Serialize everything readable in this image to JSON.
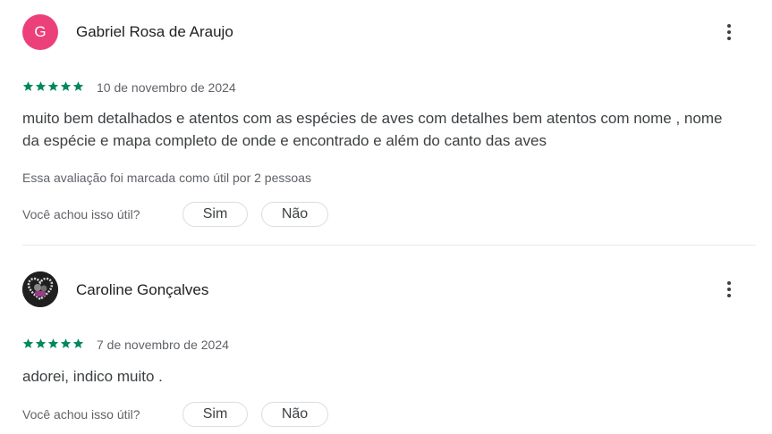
{
  "reviews": [
    {
      "avatar_letter": "G",
      "avatar_color": "#ec407a",
      "author": "Gabriel Rosa de Araujo",
      "rating": 5,
      "date": "10 de novembro de 2024",
      "text": "muito bem detalhados e atentos com as espécies de aves com detalhes bem atentos com nome , nome da espécie e mapa completo de onde e encontrado e além do canto das aves",
      "helpful_count_text": "Essa avaliação foi marcada como útil por 2 pessoas",
      "question": "Você achou isso útil?",
      "yes_label": "Sim",
      "no_label": "Não"
    },
    {
      "avatar_icon": "heart-photo-avatar",
      "author": "Caroline Gonçalves",
      "rating": 5,
      "date": "7 de novembro de 2024",
      "text": "adorei, indico muito .",
      "question": "Você achou isso útil?",
      "yes_label": "Sim",
      "no_label": "Não"
    }
  ],
  "colors": {
    "star": "#01875f",
    "text": "#3c4043",
    "muted": "#5f6368"
  }
}
